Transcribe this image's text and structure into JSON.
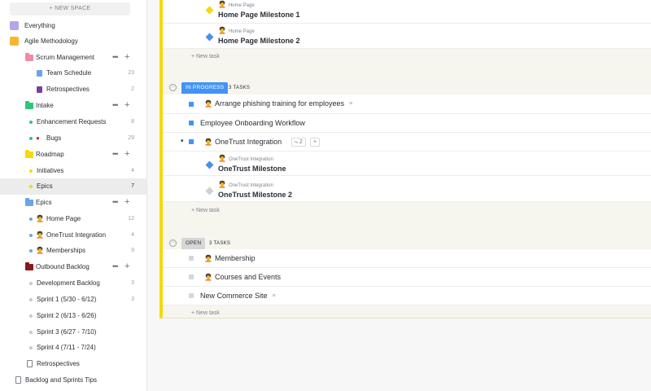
{
  "sidebar": {
    "new_space": "+ NEW SPACE",
    "everything": "Everything",
    "space": "Agile Methodology",
    "folders": [
      {
        "label": "Scrum Management",
        "lists": [
          {
            "label": "Team Schedule",
            "count": "23"
          },
          {
            "label": "Retrospectives",
            "count": "2"
          }
        ]
      },
      {
        "label": "Intake",
        "lists": [
          {
            "label": "Enhancement Requests",
            "count": "8"
          },
          {
            "label": "Bugs",
            "count": "29"
          }
        ]
      },
      {
        "label": "Roadmap",
        "lists": [
          {
            "label": "Initiatives",
            "count": "4"
          },
          {
            "label": "Epics",
            "count": "7"
          }
        ]
      },
      {
        "label": "Epics",
        "lists": [
          {
            "label": "Home Page",
            "count": "12"
          },
          {
            "label": "OneTrust Integration",
            "count": "4"
          },
          {
            "label": "Memberships",
            "count": "9"
          }
        ]
      },
      {
        "label": "Outbound Backlog",
        "lists": [
          {
            "label": "Development Backlog",
            "count": "3"
          },
          {
            "label": "Sprint 1 (5/30 - 6/12)",
            "count": "3"
          },
          {
            "label": "Sprint 2 (6/13 - 6/26)",
            "count": ""
          },
          {
            "label": "Sprint 3 (6/27 - 7/10)",
            "count": ""
          },
          {
            "label": "Sprint 4 (7/11 - 7/24)",
            "count": ""
          },
          {
            "label": "Retrospectives",
            "count": ""
          }
        ]
      }
    ],
    "tips_doc": "Backlog and Sprints Tips",
    "dots": "•••",
    "plus": "+"
  },
  "board": {
    "top_tasks": [
      {
        "parent": "Home Page",
        "name": "Home Page Milestone 1",
        "color": "#f5d90a"
      },
      {
        "parent": "Home Page",
        "name": "Home Page Milestone 2",
        "color": "#4a90e2"
      }
    ],
    "new_task": "+ New task",
    "in_progress": {
      "status": "IN PROGRESS",
      "count": "3 TASKS",
      "color": "#4194f6",
      "tasks": [
        {
          "name": "Arrange phishing training for employees"
        },
        {
          "name": "Employee Onboarding Workflow"
        },
        {
          "name": "OneTrust Integration",
          "subtasks": "2"
        }
      ],
      "milestones": [
        {
          "parent": "OneTrust Integration",
          "name": "OneTrust Milestone",
          "color": "#4a90e2"
        },
        {
          "parent": "OneTrust Integration",
          "name": "OneTrust Milestone 2",
          "color": "#d0d0d0"
        }
      ]
    },
    "open": {
      "status": "OPEN",
      "count": "3 TASKS",
      "color": "#d6d6d6",
      "tasks": [
        {
          "name": "Membership"
        },
        {
          "name": "Courses and Events"
        },
        {
          "name": "New Commerce Site"
        }
      ]
    }
  },
  "icons": {
    "avatar": "🧑‍🦱",
    "description": "description-icon",
    "subtask": "subtask-icon"
  }
}
